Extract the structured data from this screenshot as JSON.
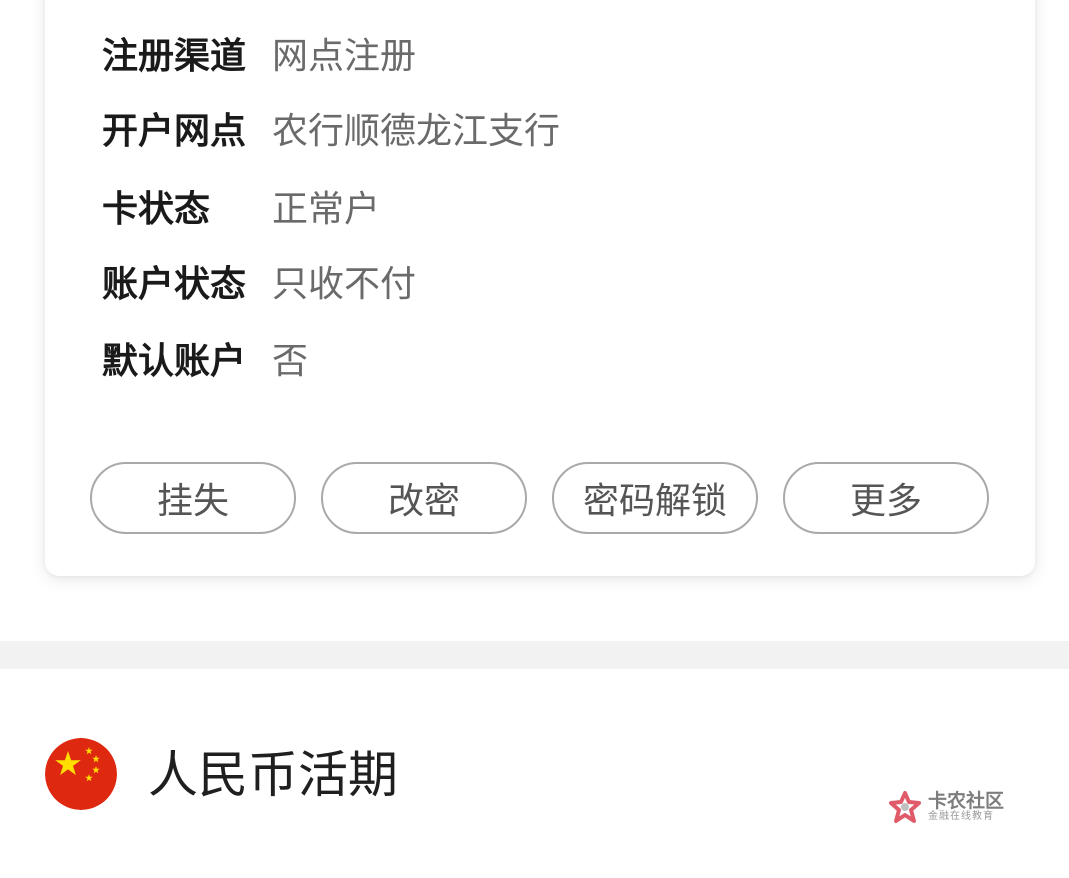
{
  "account_info": {
    "rows": [
      {
        "label": "注册渠道",
        "value": "网点注册"
      },
      {
        "label": "开户网点",
        "value": "农行顺德龙江支行"
      },
      {
        "label": "卡状态",
        "value": "正常户"
      },
      {
        "label": "账户状态",
        "value": "只收不付"
      },
      {
        "label": "默认账户",
        "value": "否"
      }
    ]
  },
  "actions": {
    "report_loss": "挂失",
    "change_password": "改密",
    "unlock_password": "密码解锁",
    "more": "更多"
  },
  "currency_section": {
    "flag_icon": "china-flag-icon",
    "title": "人民币活期"
  },
  "watermark": {
    "name": "卡农社区",
    "tagline": "金融在线教育"
  },
  "colors": {
    "flag_red": "#DE2910",
    "flag_star": "#FFDE00"
  }
}
